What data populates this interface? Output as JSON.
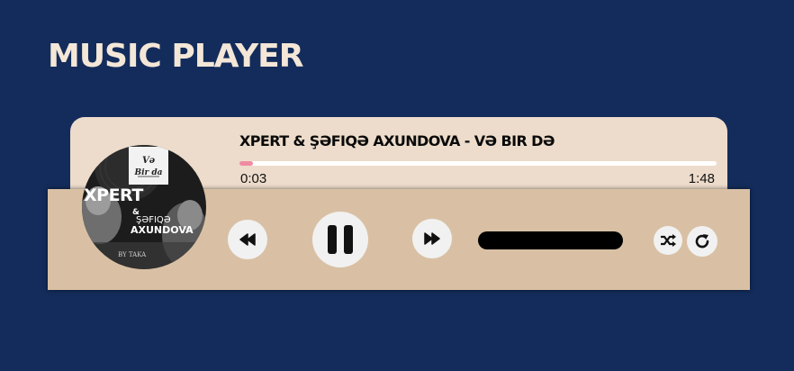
{
  "page": {
    "title": "MUSIC PLAYER"
  },
  "player": {
    "track_title": "XPERT & ŞƏFIQƏ AXUNDOVA - VƏ BIR DƏ",
    "current_time": "0:03",
    "duration": "1:48",
    "progress_fraction": 0.028,
    "album_art": {
      "sticker_text_line1": "Və",
      "sticker_text_line2": "Bir da",
      "artist_text": "XPERT",
      "ampersand": "&",
      "featured_line1": "ŞƏFIQƏ",
      "featured_line2": "AXUNDOVA",
      "footer_text": "BY TAKA"
    },
    "controls": {
      "rewind_icon": "rewind-icon",
      "pause_icon": "pause-icon",
      "forward_icon": "fast-forward-icon",
      "shuffle_icon": "shuffle-icon",
      "repeat_icon": "repeat-icon"
    }
  },
  "colors": {
    "background": "#132c5b",
    "title": "#f4e7d7",
    "info_card": "#eddccb",
    "control_bar": "#d9c0a4",
    "progress_fill": "#f08aa2",
    "button": "#f1f1f1"
  }
}
